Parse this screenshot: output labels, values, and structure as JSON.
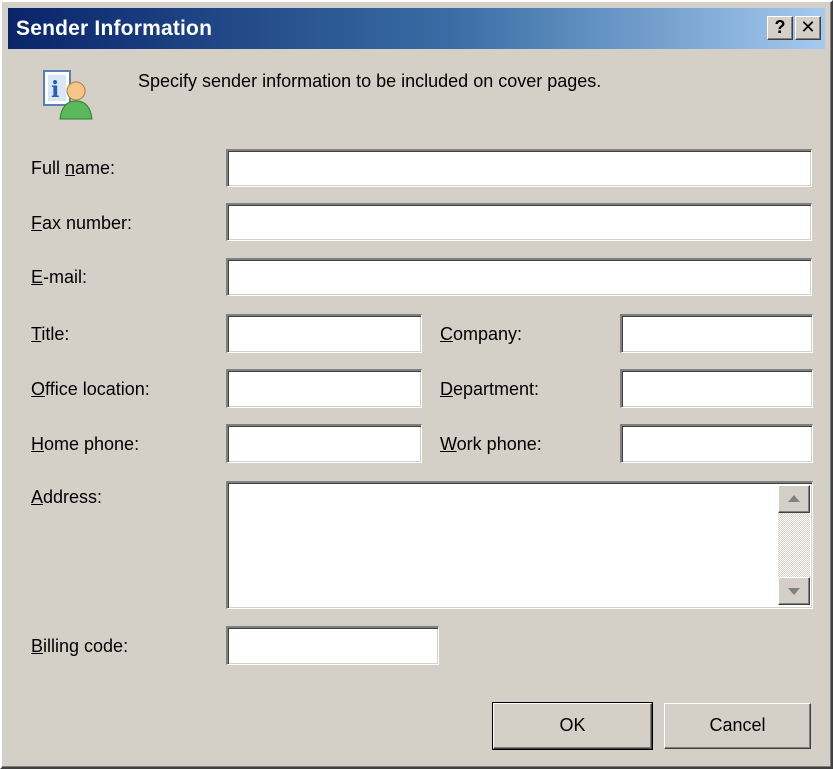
{
  "window": {
    "title": "Sender Information",
    "help_label": "?",
    "close_label": "✕"
  },
  "intro": {
    "text": "Specify sender information to be included on cover pages.",
    "icon": "contact-info-icon"
  },
  "fields": {
    "full_name": {
      "label_pre": "Full ",
      "label_key": "n",
      "label_post": "ame:",
      "value": ""
    },
    "fax_number": {
      "label_pre": "",
      "label_key": "F",
      "label_post": "ax number:",
      "value": ""
    },
    "email": {
      "label_pre": "",
      "label_key": "E",
      "label_post": "-mail:",
      "value": ""
    },
    "title": {
      "label_pre": "",
      "label_key": "T",
      "label_post": "itle:",
      "value": ""
    },
    "company": {
      "label_pre": "",
      "label_key": "C",
      "label_post": "ompany:",
      "value": ""
    },
    "office_location": {
      "label_pre": "",
      "label_key": "O",
      "label_post": "ffice location:",
      "value": ""
    },
    "department": {
      "label_pre": "",
      "label_key": "D",
      "label_post": "epartment:",
      "value": ""
    },
    "home_phone": {
      "label_pre": "",
      "label_key": "H",
      "label_post": "ome phone:",
      "value": ""
    },
    "work_phone": {
      "label_pre": "",
      "label_key": "W",
      "label_post": "ork phone:",
      "value": ""
    },
    "address": {
      "label_pre": "",
      "label_key": "A",
      "label_post": "ddress:",
      "value": ""
    },
    "billing_code": {
      "label_pre": "",
      "label_key": "B",
      "label_post": "illing code:",
      "value": ""
    }
  },
  "buttons": {
    "ok": "OK",
    "cancel": "Cancel"
  },
  "colors": {
    "face": "#d4d0c8",
    "title_start": "#0a246a",
    "title_end": "#a6caf0"
  }
}
